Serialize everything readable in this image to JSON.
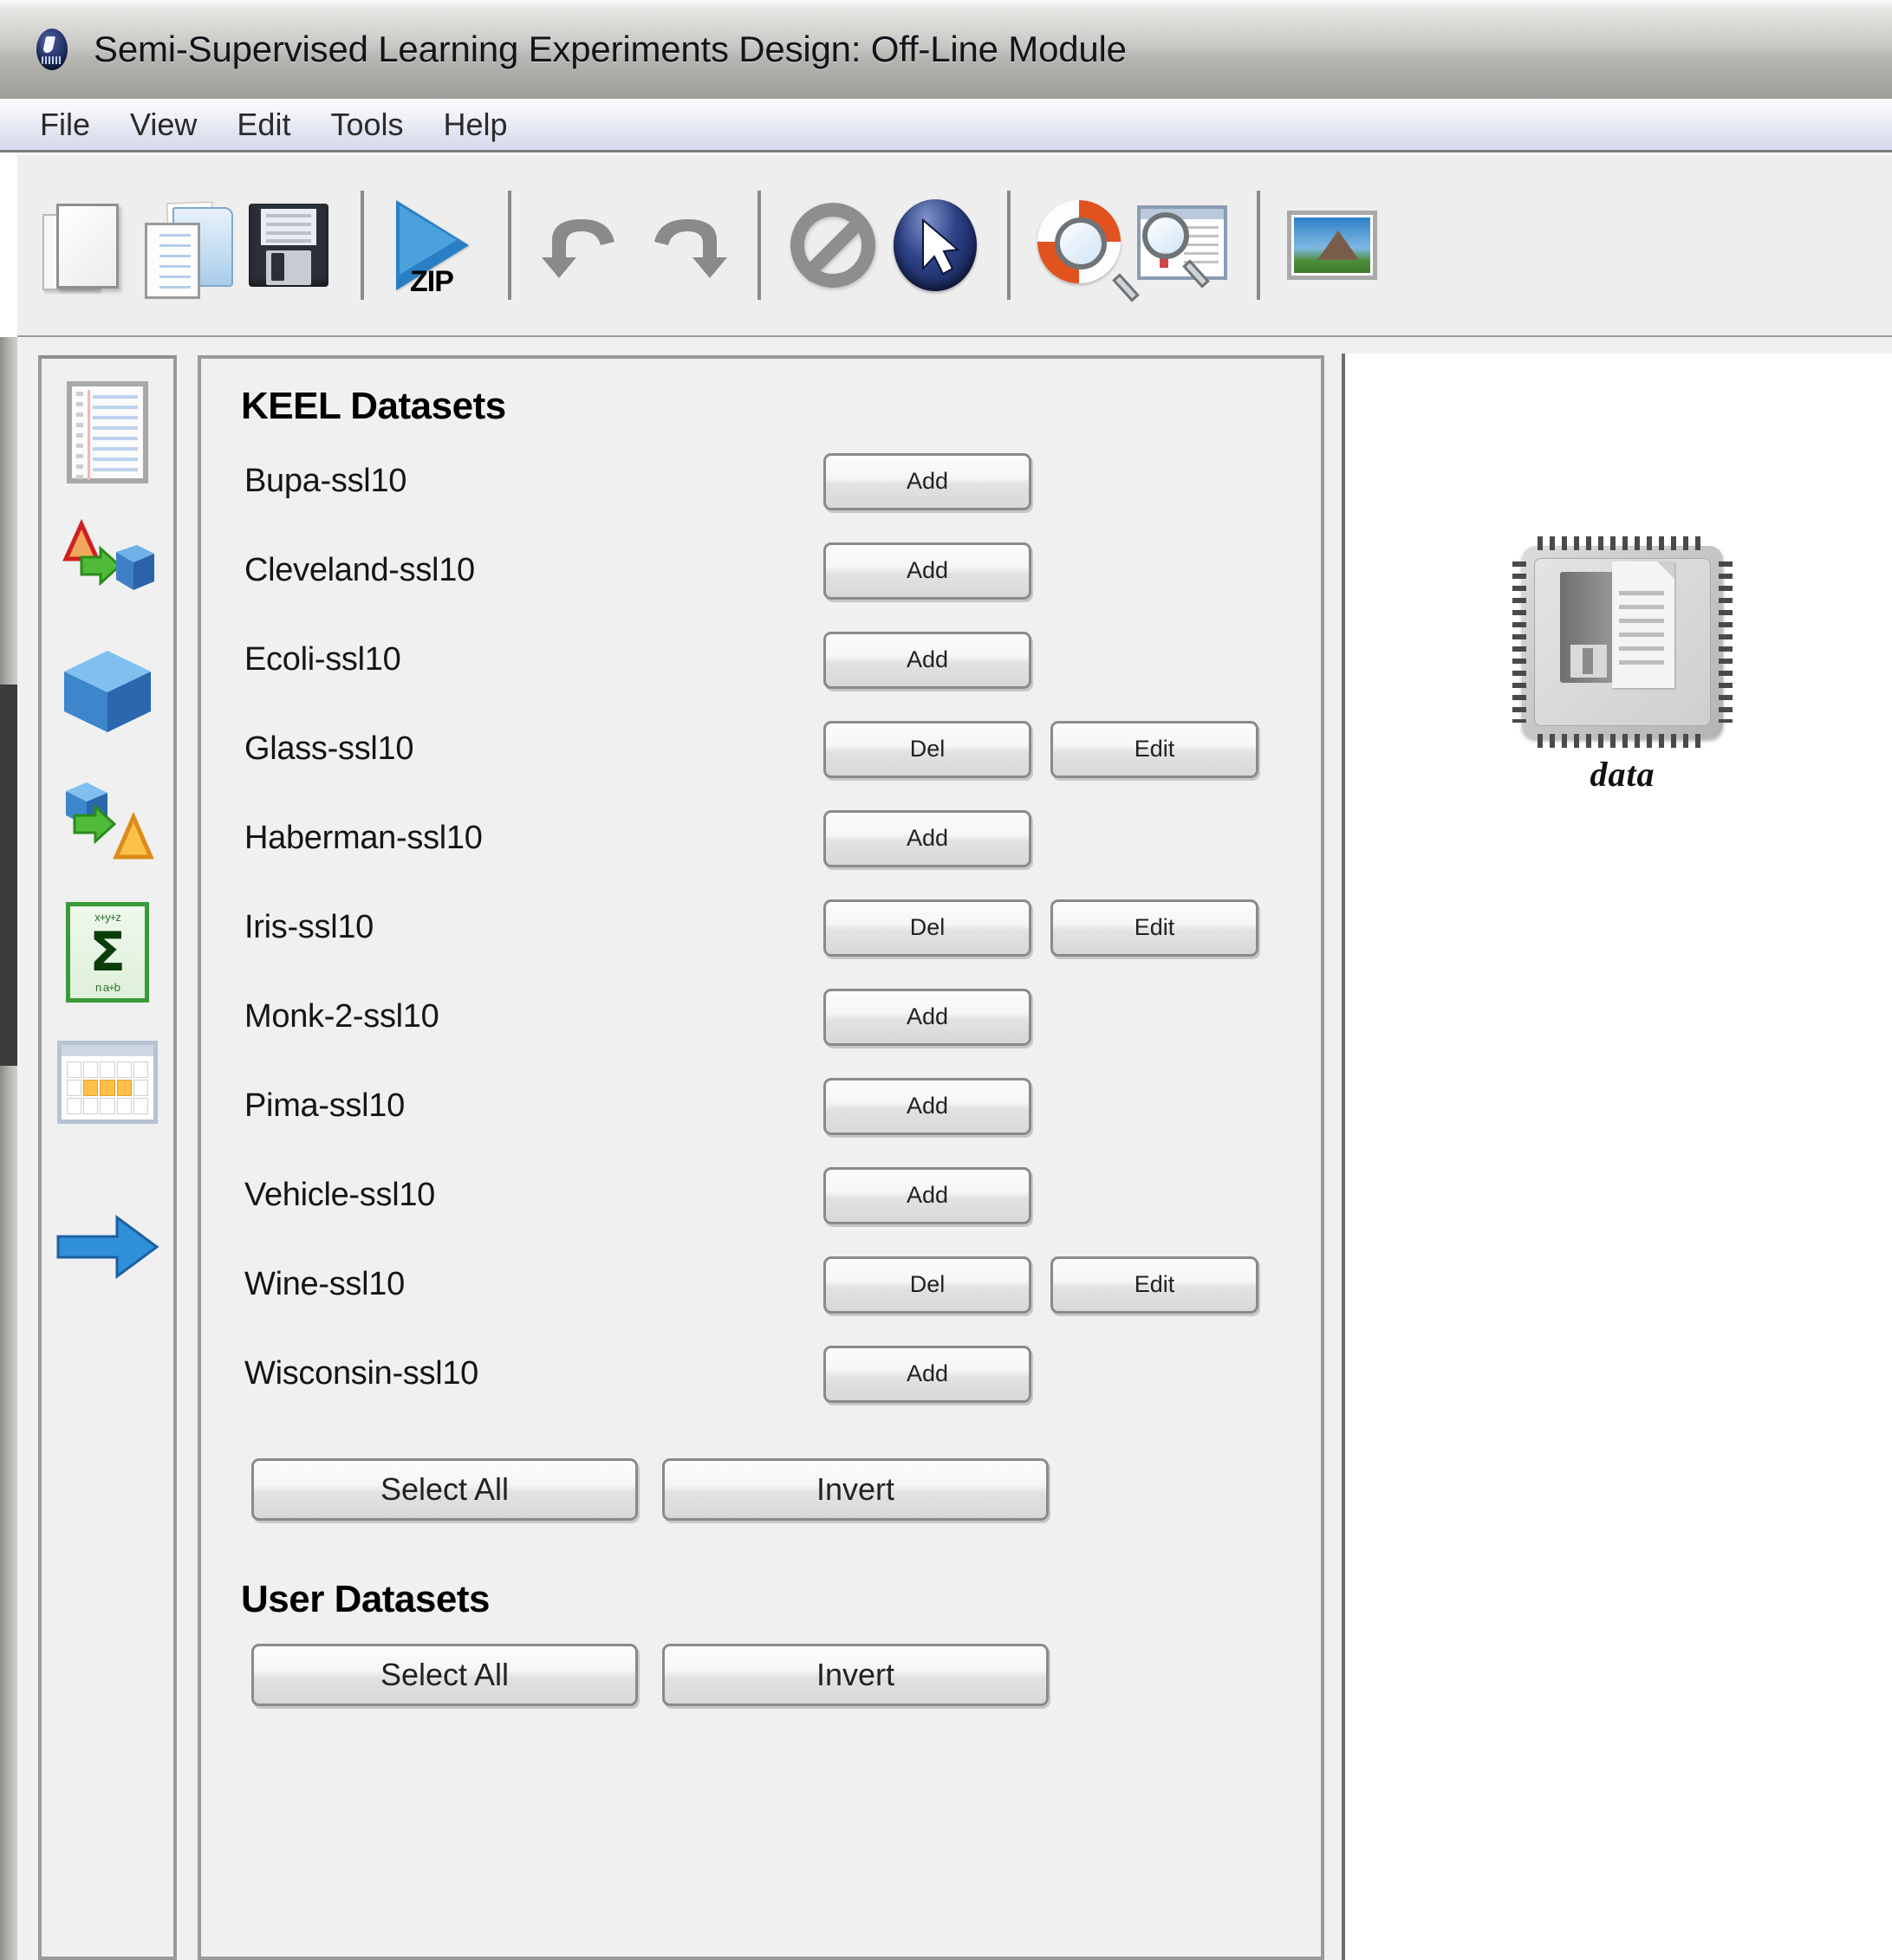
{
  "window": {
    "title": "Semi-Supervised Learning Experiments Design: Off-Line Module",
    "app_icon": "globe-icon"
  },
  "menubar": {
    "items": [
      {
        "label": "File"
      },
      {
        "label": "View"
      },
      {
        "label": "Edit"
      },
      {
        "label": "Tools"
      },
      {
        "label": "Help"
      }
    ]
  },
  "toolbar": {
    "buttons": [
      {
        "name": "new-document-icon",
        "label": "New"
      },
      {
        "name": "open-document-icon",
        "label": "Open"
      },
      {
        "name": "save-floppy-icon",
        "label": "Save"
      },
      {
        "name": "zip-run-icon",
        "label": "ZIP"
      },
      {
        "name": "undo-icon",
        "label": "Undo"
      },
      {
        "name": "redo-icon",
        "label": "Redo"
      },
      {
        "name": "no-entry-icon",
        "label": "Cancel"
      },
      {
        "name": "select-cursor-icon",
        "label": "Select"
      },
      {
        "name": "help-search-icon",
        "label": "Help"
      },
      {
        "name": "document-preview-icon",
        "label": "Preview"
      },
      {
        "name": "picture-icon",
        "label": "Image"
      }
    ],
    "zip_label": "ZIP"
  },
  "sidebar": {
    "items": [
      {
        "name": "sidebar-item-datasets",
        "icon": "lined-document-icon"
      },
      {
        "name": "sidebar-item-preprocess",
        "icon": "cone-arrow-cube-icon"
      },
      {
        "name": "sidebar-item-methods",
        "icon": "blue-cube-icon"
      },
      {
        "name": "sidebar-item-postprocess",
        "icon": "cube-arrow-cone-icon"
      },
      {
        "name": "sidebar-item-statistics",
        "icon": "sigma-icon"
      },
      {
        "name": "sidebar-item-visualization",
        "icon": "table-grid-icon"
      },
      {
        "name": "sidebar-item-connection",
        "icon": "blue-right-arrow-icon"
      }
    ],
    "sigma_glyph": "Σ",
    "sigma_top": "x+y+z",
    "sigma_bottom": "n  a+b"
  },
  "main": {
    "keel_section_title": "KEEL Datasets",
    "user_section_title": "User Datasets",
    "datasets": [
      {
        "name": "Bupa-ssl10",
        "actions": [
          {
            "label": "Add"
          }
        ]
      },
      {
        "name": "Cleveland-ssl10",
        "actions": [
          {
            "label": "Add"
          }
        ]
      },
      {
        "name": "Ecoli-ssl10",
        "actions": [
          {
            "label": "Add"
          }
        ]
      },
      {
        "name": "Glass-ssl10",
        "actions": [
          {
            "label": "Del"
          },
          {
            "label": "Edit"
          }
        ]
      },
      {
        "name": "Haberman-ssl10",
        "actions": [
          {
            "label": "Add"
          }
        ]
      },
      {
        "name": "Iris-ssl10",
        "actions": [
          {
            "label": "Del"
          },
          {
            "label": "Edit"
          }
        ]
      },
      {
        "name": "Monk-2-ssl10",
        "actions": [
          {
            "label": "Add"
          }
        ]
      },
      {
        "name": "Pima-ssl10",
        "actions": [
          {
            "label": "Add"
          }
        ]
      },
      {
        "name": "Vehicle-ssl10",
        "actions": [
          {
            "label": "Add"
          }
        ]
      },
      {
        "name": "Wine-ssl10",
        "actions": [
          {
            "label": "Del"
          },
          {
            "label": "Edit"
          }
        ]
      },
      {
        "name": "Wisconsin-ssl10",
        "actions": [
          {
            "label": "Add"
          }
        ]
      }
    ],
    "keel_select_all_label": "Select All",
    "keel_invert_label": "Invert",
    "user_select_all_label": "Select All",
    "user_invert_label": "Invert"
  },
  "canvas": {
    "nodes": [
      {
        "label": "data",
        "icon": "data-chip-icon"
      }
    ]
  },
  "colors": {
    "window_bg": "#f0f0f0",
    "panel_border": "#9a9a9a",
    "menubar_bg": "#dfe2f0",
    "canvas_bg": "#ffffff",
    "accent_blue": "#2a7fc4",
    "sigma_green": "#3a9a3a",
    "highlight_orange": "#fdc04a"
  }
}
